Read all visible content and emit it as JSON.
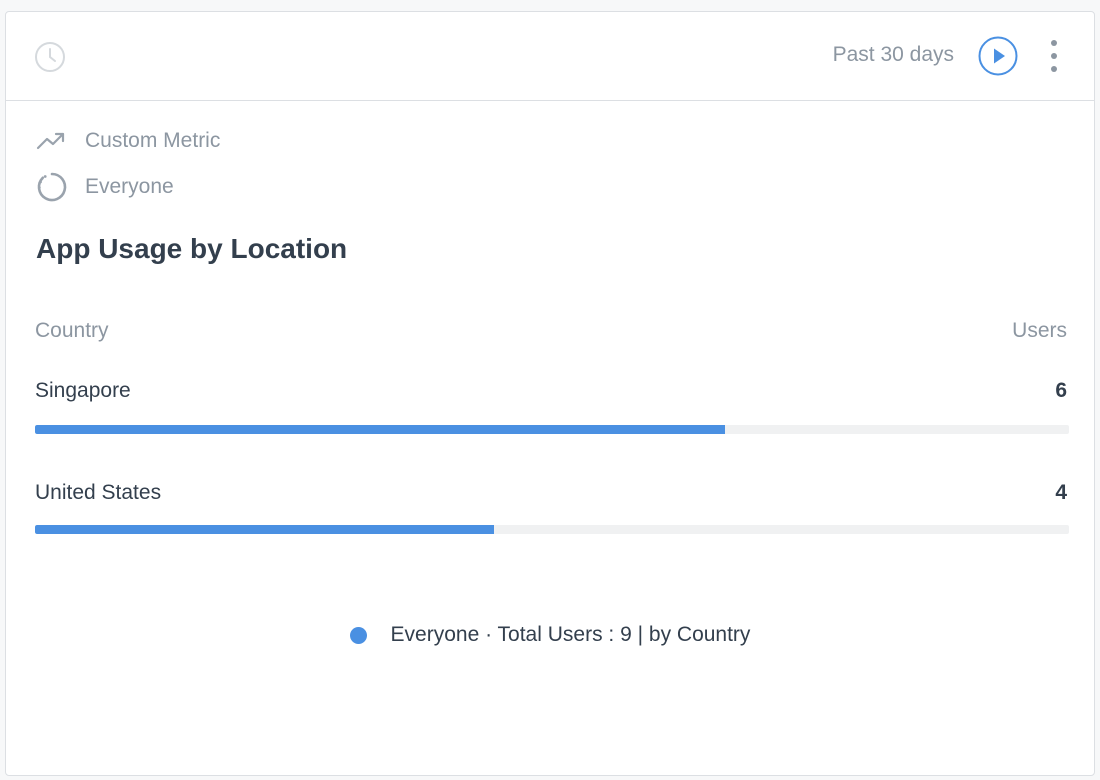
{
  "header": {
    "icon": "clock-icon",
    "period": "Past 30 days",
    "play_icon": "play-circle-icon",
    "more_icon": "vertical-ellipsis-icon"
  },
  "meta": {
    "metric_label": "Custom Metric",
    "metric_icon": "trending-up-icon",
    "segment_label": "Everyone",
    "segment_icon": "dashed-circle-icon"
  },
  "title": "App Usage by Location",
  "table": {
    "col_country": "Country",
    "col_users": "Users",
    "rows": [
      {
        "country": "Singapore",
        "users": "6",
        "fill": 0.667
      },
      {
        "country": "United States",
        "users": "4",
        "fill": 0.444
      }
    ]
  },
  "legend": {
    "text": "Everyone · Total Users : 9 | by Country"
  },
  "colors": {
    "accent": "#4a90e2",
    "track": "#f0f1f2",
    "text_dark": "#333f4d",
    "text_muted": "#8c96a1"
  }
}
